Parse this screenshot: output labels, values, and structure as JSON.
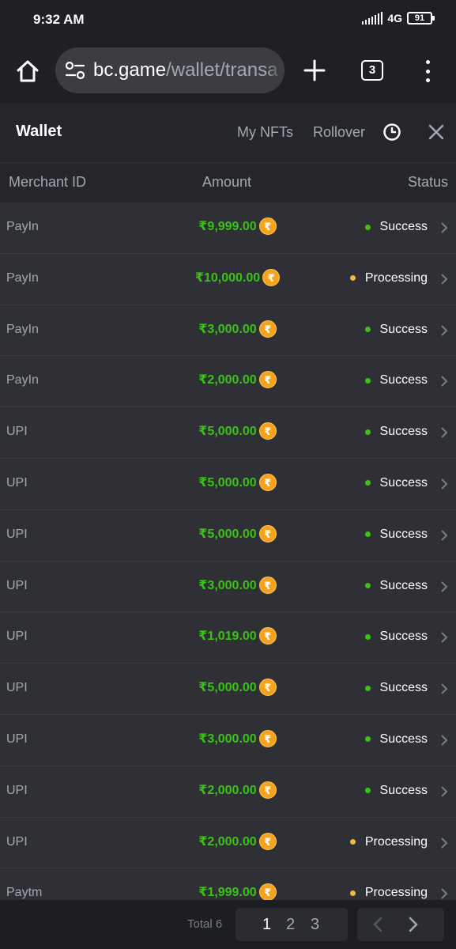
{
  "statusbar": {
    "time": "9:32 AM",
    "network": "4G",
    "battery": "91"
  },
  "browser": {
    "url_host": "bc.game",
    "url_path": "/wallet/transa",
    "tab_count": "3"
  },
  "wallet": {
    "title": "Wallet",
    "nfts_label": "My NFTs",
    "rollover_label": "Rollover"
  },
  "columns": {
    "merchant": "Merchant ID",
    "amount": "Amount",
    "status": "Status"
  },
  "currency_glyph": "₹",
  "rows": [
    {
      "merchant": "PayIn",
      "amount": "₹9,999.00",
      "status": "Success"
    },
    {
      "merchant": "PayIn",
      "amount": "₹10,000.00",
      "status": "Processing"
    },
    {
      "merchant": "PayIn",
      "amount": "₹3,000.00",
      "status": "Success"
    },
    {
      "merchant": "PayIn",
      "amount": "₹2,000.00",
      "status": "Success"
    },
    {
      "merchant": "UPI",
      "amount": "₹5,000.00",
      "status": "Success"
    },
    {
      "merchant": "UPI",
      "amount": "₹5,000.00",
      "status": "Success"
    },
    {
      "merchant": "UPI",
      "amount": "₹5,000.00",
      "status": "Success"
    },
    {
      "merchant": "UPI",
      "amount": "₹3,000.00",
      "status": "Success"
    },
    {
      "merchant": "UPI",
      "amount": "₹1,019.00",
      "status": "Success"
    },
    {
      "merchant": "UPI",
      "amount": "₹5,000.00",
      "status": "Success"
    },
    {
      "merchant": "UPI",
      "amount": "₹3,000.00",
      "status": "Success"
    },
    {
      "merchant": "UPI",
      "amount": "₹2,000.00",
      "status": "Success"
    },
    {
      "merchant": "UPI",
      "amount": "₹2,000.00",
      "status": "Processing"
    },
    {
      "merchant": "Paytm",
      "amount": "₹1,999.00",
      "status": "Processing"
    }
  ],
  "pagination": {
    "total_label": "Total 6",
    "pages": [
      "1",
      "2",
      "3"
    ],
    "current_page": "1"
  },
  "colors": {
    "success": "#3bc117",
    "processing": "#f5b63d",
    "coin": "#f7a21b",
    "amount": "#3bc117"
  },
  "icons": [
    "home-icon",
    "tune-icon",
    "plus-icon",
    "tab-switcher-icon",
    "more-vert-icon",
    "clock-icon",
    "close-icon",
    "chevron-right-icon",
    "chevron-left-icon"
  ]
}
